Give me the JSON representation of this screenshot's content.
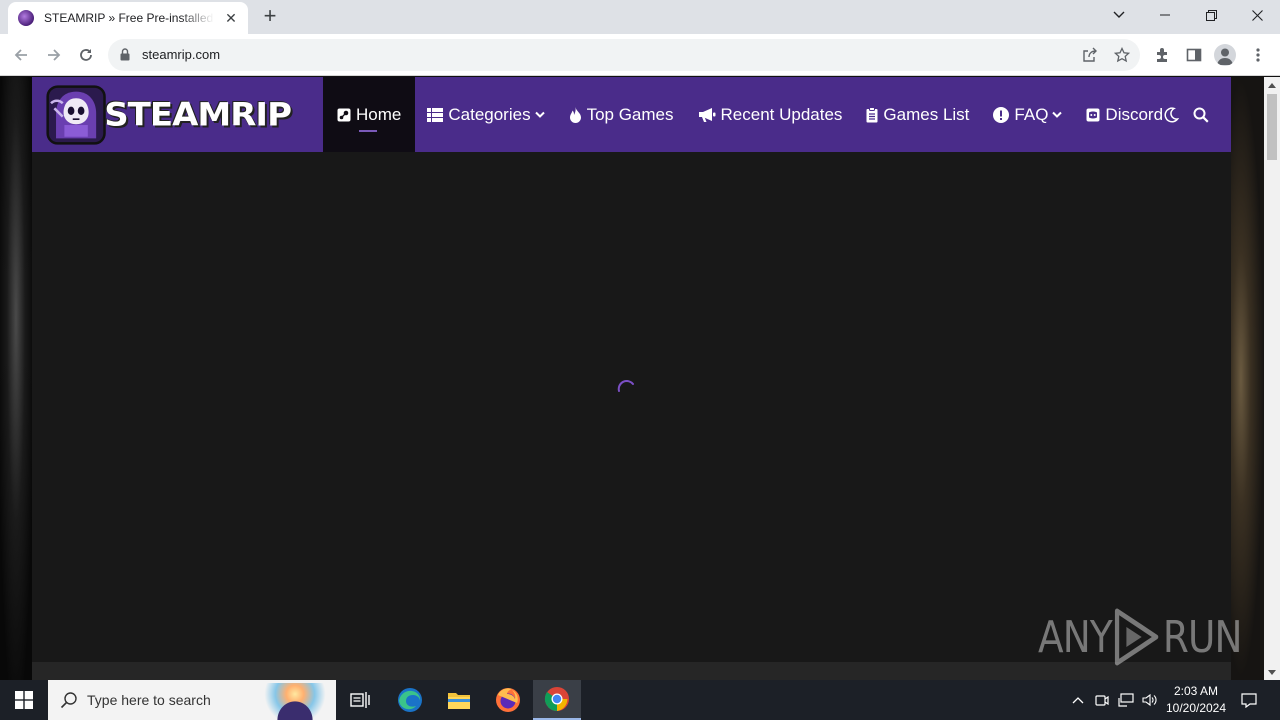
{
  "browser": {
    "tab": {
      "title": "STEAMRIP » Free Pre-installed Steam Games"
    },
    "address": {
      "url": "steamrip.com"
    }
  },
  "site": {
    "logo_text": "STEAMRIP",
    "nav": [
      {
        "label": "Home",
        "icon": "steam-icon",
        "active": true
      },
      {
        "label": "Categories",
        "icon": "grid-list-icon",
        "dropdown": true
      },
      {
        "label": "Top Games",
        "icon": "fire-icon"
      },
      {
        "label": "Recent Updates",
        "icon": "bullhorn-icon"
      },
      {
        "label": "Games List",
        "icon": "clipboard-icon"
      },
      {
        "label": "FAQ",
        "icon": "exclamation-circle-icon",
        "dropdown": true
      },
      {
        "label": "Discord",
        "icon": "discord-icon"
      }
    ],
    "accent_color": "#4a2c8a",
    "content_background": "#181818",
    "loading": true
  },
  "watermark": {
    "text_left": "ANY",
    "text_right": "RUN"
  },
  "taskbar": {
    "search_placeholder": "Type here to search",
    "apps": [
      "task-view-icon",
      "edge-icon",
      "file-explorer-icon",
      "firefox-icon",
      "chrome-icon"
    ],
    "active_app": "chrome-icon",
    "time": "2:03 AM",
    "date": "10/20/2024"
  }
}
